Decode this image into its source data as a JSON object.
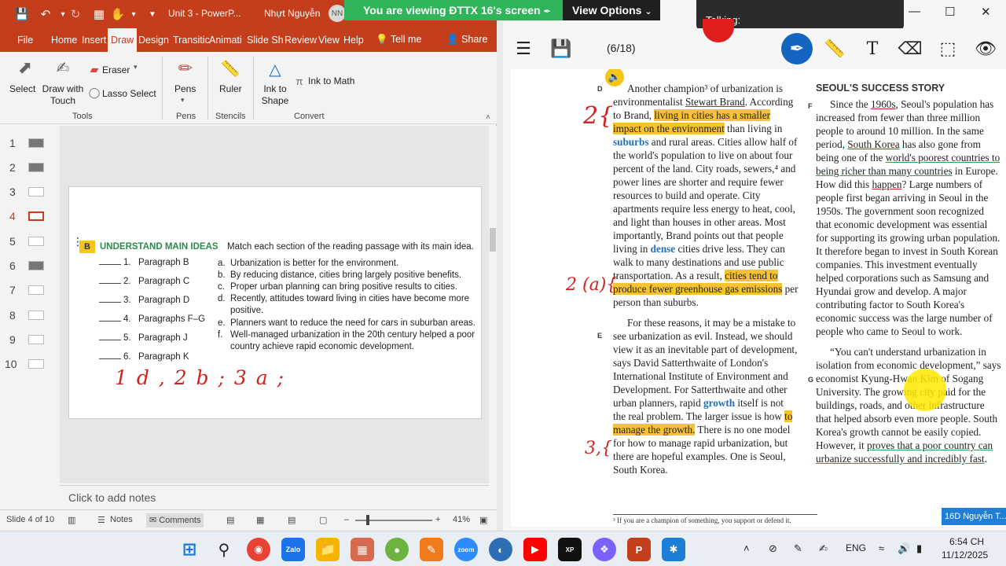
{
  "ppt": {
    "doc_title": "Unit 3  -  PowerP...",
    "user_name": "Nhựt Nguyễn",
    "user_initials": "NN",
    "tabs": [
      "File",
      "Home",
      "Insert",
      "Draw",
      "Design",
      "Transitic",
      "Animati",
      "Slide Sh",
      "Review",
      "View",
      "Help"
    ],
    "tell_me": "Tell me",
    "share": "Share",
    "ribbon": {
      "select": "Select",
      "draw_with_touch": "Draw with Touch",
      "eraser": "Eraser",
      "lasso_select": "Lasso Select",
      "pens": "Pens",
      "ruler": "Ruler",
      "ink_to_shape": "Ink to Shape",
      "ink_to_math": "Ink to Math",
      "group_tools": "Tools",
      "group_pens": "Pens",
      "group_stencils": "Stencils",
      "group_convert": "Convert"
    },
    "thumb_numbers": [
      "1",
      "2",
      "3",
      "4",
      "5",
      "6",
      "7",
      "8",
      "9",
      "10"
    ],
    "active_slide": 4,
    "slide": {
      "badge": "B",
      "heading": "UNDERSTAND MAIN IDEAS",
      "subheading": "Match each section of the reading passage with its main idea.",
      "blanks": [
        {
          "num": "1.",
          "para": "Paragraph B"
        },
        {
          "num": "2.",
          "para": "Paragraph C"
        },
        {
          "num": "3.",
          "para": "Paragraph D"
        },
        {
          "num": "4.",
          "para": "Paragraphs F–G"
        },
        {
          "num": "5.",
          "para": "Paragraph J"
        },
        {
          "num": "6.",
          "para": "Paragraph K"
        }
      ],
      "options": [
        {
          "letter": "a.",
          "text": "Urbanization is better for the environment."
        },
        {
          "letter": "b.",
          "text": "By reducing distance, cities bring largely positive benefits."
        },
        {
          "letter": "c.",
          "text": "Proper urban planning can bring positive results to cities."
        },
        {
          "letter": "d.",
          "text": "Recently, attitudes toward living in cities have become more positive."
        },
        {
          "letter": "e.",
          "text": "Planners want to reduce the need for cars in suburban areas."
        },
        {
          "letter": "f.",
          "text": "Well-managed urbanization in the 20th century helped a poor country achieve rapid economic development."
        }
      ],
      "ink_answer": "1 d , 2 b ; 3 a ;"
    },
    "notes_placeholder": "Click to add notes",
    "status": {
      "slide_of": "Slide 4 of 10",
      "notes": "Notes",
      "comments": "Comments",
      "zoom": "41%"
    }
  },
  "share": {
    "viewing_text": "You are viewing  ĐTTX 16's screen",
    "view_options": "View Options",
    "talking": "Talking:",
    "page_count": "(6/18)",
    "name_tag": "16D Nguyễn T..."
  },
  "textbook": {
    "left_col": {
      "section_d": "D",
      "section_e": "E",
      "para_d": [
        "Another champion³ of urbanization is environmentalist ",
        "Stewart Brand",
        ". According to Brand, ",
        "living in cities has a smaller impact on the environment",
        " than living in ",
        "suburbs",
        " and rural areas. Cities allow half of the world's population to live on about four percent of the land. City roads, sewers,⁴ and power lines are shorter and require fewer resources to build and operate. City apartments require less energy to heat, cool, and light than houses in other areas. Most importantly, Brand points out that people living in ",
        "dense",
        " cities drive less. They can walk to many destinations and use public transportation. As a result, ",
        "cities tend to produce fewer greenhouse gas emissions",
        " per person than suburbs."
      ],
      "para_e": [
        "For these reasons, it may be a mistake to see urbanization as evil. Instead, we should view it as an inevitable part of development, says David Satterthwaite of London's International Institute of Environment and Development. For Satterthwaite and other urban planners, rapid ",
        "growth",
        " itself is not the real problem. The larger issue is how ",
        "to manage the growth.",
        " There is no one model for how to manage rapid urbanization, but there are hopeful examples. One is Seoul, South Korea."
      ],
      "footnote": "³ If you are a champion of something, you support or defend it."
    },
    "right_col": {
      "title": "SEOUL'S SUCCESS STORY",
      "section_f": "F",
      "section_g": "G",
      "para_f": [
        "Since the ",
        "1960s",
        ", Seoul's population has increased from fewer than three million people to around 10 million. In the same period, ",
        "South Korea",
        " has also gone from being one of the ",
        "world's poorest countries to being richer than many countries",
        " in Europe. How did this ",
        "happen",
        "? Large numbers of people first began arriving in Seoul in the 1950s. The government soon recognized that economic development was essential for supporting its growing urban population. It therefore began to invest in South Korean companies. This investment eventually helped corporations such as Samsung and Hyundai grow and develop. A major contributing factor to South Korea's economic success was the large number of people who came to Seoul to work."
      ],
      "para_g": [
        "“You can't understand urbanization in isolation from economic development,” says economist Kyung-Hwan Kim of Sogang University. The growing city paid for the buildings, roads, and other infrastructure that helped absorb even more people. South Korea's growth cannot be easily copied. However, it ",
        "proves that a poor country can urbanize successfully and incredibly fast",
        "."
      ]
    },
    "ink_marks": {
      "d": "2{",
      "mid": "2 (a){",
      "e": "3,{"
    }
  },
  "taskbar": {
    "apps": [
      "start",
      "search",
      "chrome",
      "zalo",
      "file-explorer",
      "app",
      "app",
      "app",
      "zoom",
      "app",
      "youtube",
      "xp-pen",
      "copilot",
      "powerpoint",
      "app"
    ],
    "lang": "ENG",
    "time": "6:54 CH",
    "date": "11/12/2025"
  }
}
